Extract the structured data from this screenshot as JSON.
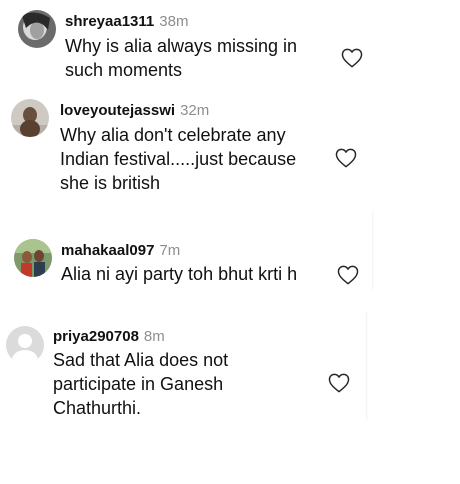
{
  "comments": [
    {
      "username": "shreyaa1311",
      "time": "38m",
      "text": "Why is alia always missing in\nsuch moments"
    },
    {
      "username": "loveyoutejasswi",
      "time": "32m",
      "text": "Why alia don't celebrate any\nIndian festival.....just because\nshe is british"
    },
    {
      "username": "mahakaal097",
      "time": "7m",
      "text": "Alia ni ayi party toh bhut krti h"
    },
    {
      "username": "priya290708",
      "time": "8m",
      "text": "Sad that Alia does not\nparticipate in Ganesh\nChathurthi."
    }
  ],
  "icons": {
    "like": "heart-outline-icon",
    "default_avatar": "default-user-avatar-icon"
  },
  "colors": {
    "text": "#111111",
    "timestamp": "#8e8e8e",
    "heart_stroke": "#262626"
  }
}
